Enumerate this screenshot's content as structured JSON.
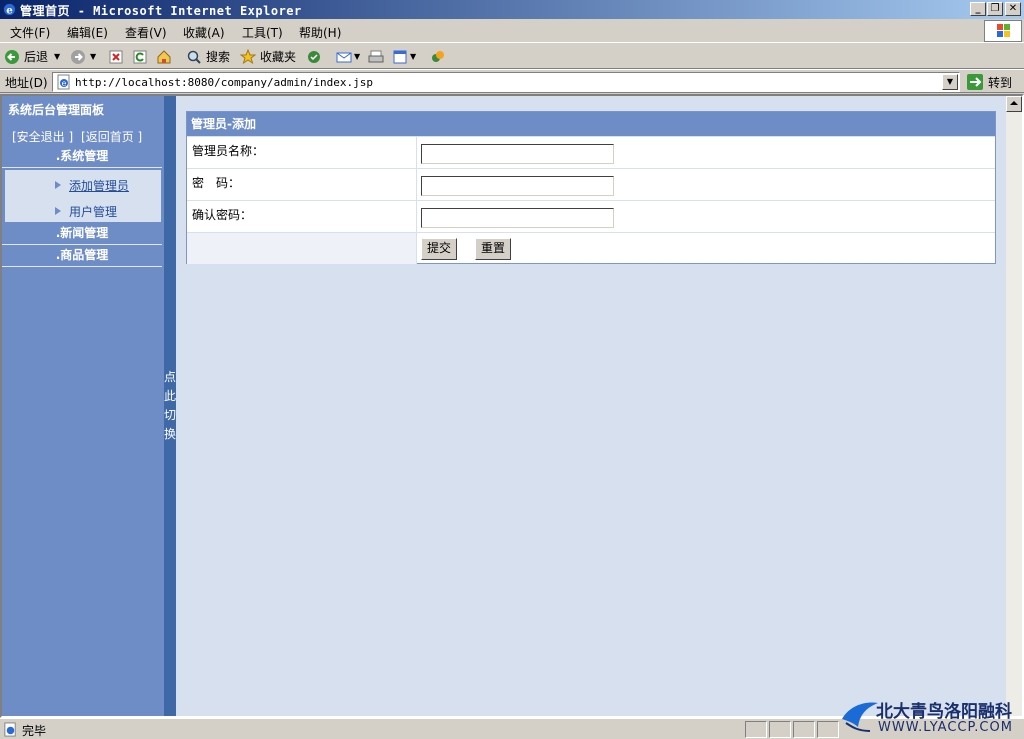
{
  "window": {
    "title": "管理首页 - Microsoft Internet Explorer",
    "min_glyph": "_",
    "max_glyph": "❐",
    "close_glyph": "✕"
  },
  "menu": {
    "items": [
      "文件(F)",
      "编辑(E)",
      "查看(V)",
      "收藏(A)",
      "工具(T)",
      "帮助(H)"
    ]
  },
  "toolbar": {
    "back_label": "后退",
    "search_label": "搜索",
    "favorites_label": "收藏夹"
  },
  "address": {
    "label": "地址(D)",
    "url": "http://localhost:8080/company/admin/index.jsp",
    "go_label": "转到"
  },
  "sidebar": {
    "title": "系统后台管理面板",
    "logout_link": "[安全退出 ]",
    "home_link": "[返回首页 ]",
    "sections": [
      {
        "label": ".系统管理"
      },
      {
        "label": ".新闻管理"
      },
      {
        "label": ".商品管理"
      }
    ],
    "subitems": [
      {
        "label": "添加管理员"
      },
      {
        "label": "用户管理"
      }
    ]
  },
  "divider": {
    "toggle_label": "点此切换"
  },
  "form": {
    "header": "管理员-添加",
    "fields": [
      {
        "label": "管理员名称：",
        "value": ""
      },
      {
        "label": "密　码：",
        "value": ""
      },
      {
        "label": "确认密码：",
        "value": ""
      }
    ],
    "submit_label": "提交",
    "reset_label": "重置"
  },
  "status": {
    "text": "完毕"
  },
  "watermark": {
    "line1": "北大青鸟洛阳融科",
    "line2": "WWW.LYACCP.COM"
  },
  "colors": {
    "sidebar_bg": "#6e8cc5",
    "divider_bg": "#3f68a6",
    "main_bg": "#d6e0ef",
    "form_header_bg": "#6e8cc5"
  }
}
